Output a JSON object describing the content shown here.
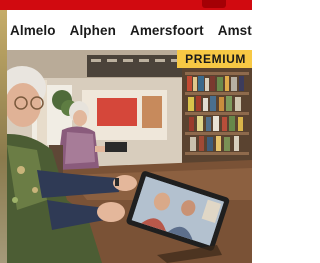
{
  "nav": {
    "cities": [
      "Almelo",
      "Alphen",
      "Amersfoort",
      "Amsterdam"
    ]
  },
  "article": {
    "badge": "PREMIUM"
  },
  "colors": {
    "brand_red": "#d10a10",
    "premium_yellow": "#f7c844"
  }
}
